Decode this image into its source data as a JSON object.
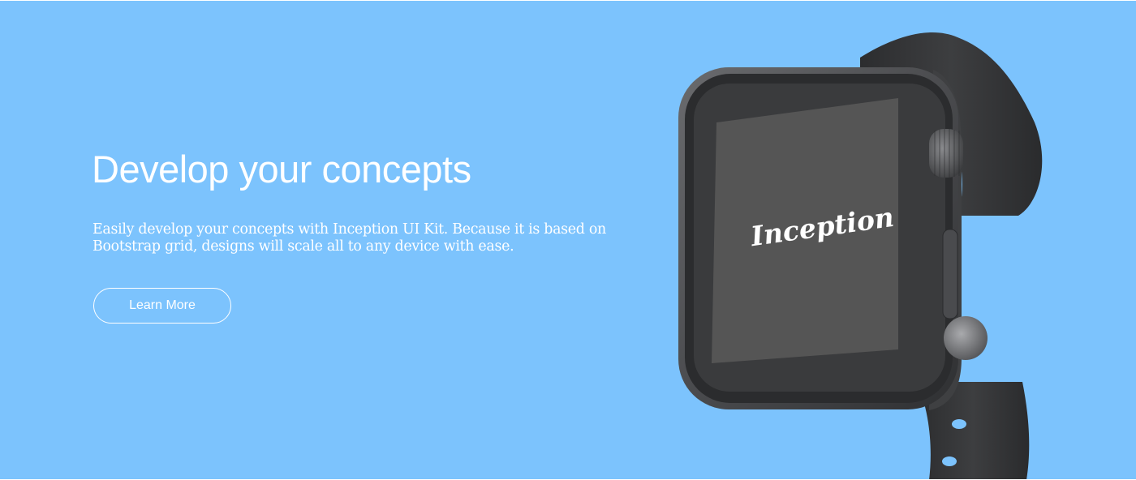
{
  "hero": {
    "title": "Develop your concepts",
    "description": "Easily develop your concepts with Inception UI Kit. Because it is based on Bootstrap grid, designs will scale all to any device with ease.",
    "cta_label": "Learn More",
    "background_color": "#7cc3fd"
  },
  "watch": {
    "screen_logo": "Inception",
    "case_color": "#4a4b4d",
    "band_color": "#3a3b3d",
    "screen_color": "#555555"
  }
}
